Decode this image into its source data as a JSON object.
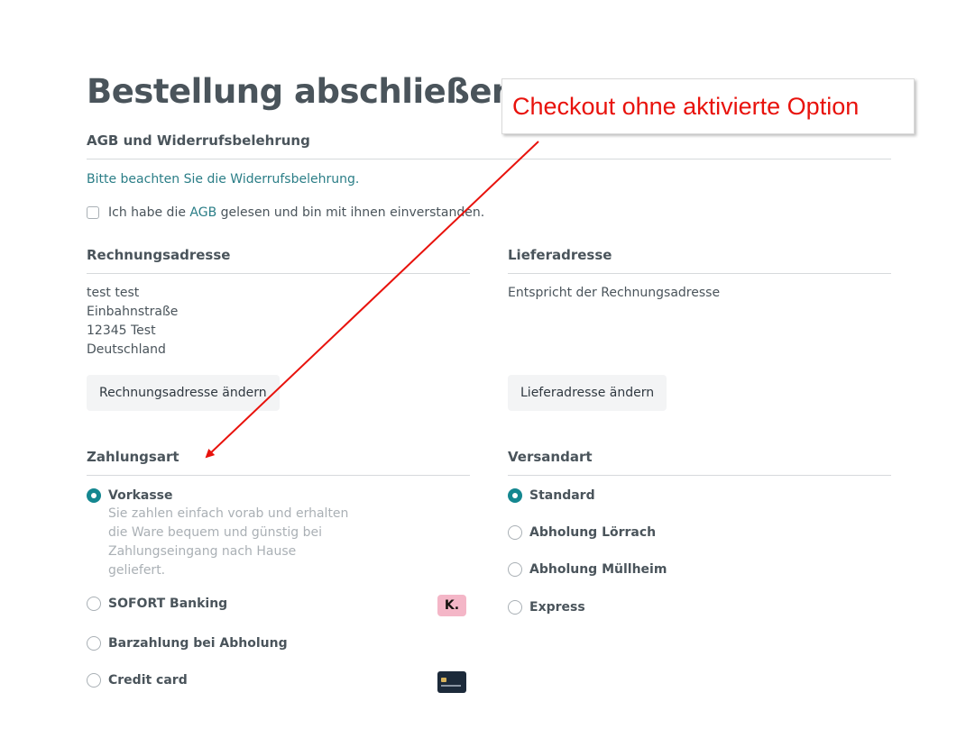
{
  "title": "Bestellung abschließen",
  "terms": {
    "heading": "AGB und Widerrufsbelehrung",
    "notice_prefix": "Bitte beachten Sie die ",
    "notice_link": "Widerrufsbelehrung",
    "notice_suffix": ".",
    "agree_prefix": "Ich habe die ",
    "agree_link": "AGB",
    "agree_suffix": " gelesen und bin mit ihnen einverstanden."
  },
  "billing": {
    "heading": "Rechnungsadresse",
    "lines": [
      "test test",
      "Einbahnstraße",
      "12345 Test",
      "Deutschland"
    ],
    "change_button": "Rechnungsadresse ändern"
  },
  "shipping_address": {
    "heading": "Lieferadresse",
    "text": "Entspricht der Rechnungsadresse",
    "change_button": "Lieferadresse ändern"
  },
  "payment": {
    "heading": "Zahlungsart",
    "options": [
      {
        "label": "Vorkasse",
        "checked": true,
        "description": "Sie zahlen einfach vorab und erhalten die Ware bequem und günstig bei Zahlungseingang nach Hause geliefert."
      },
      {
        "label": "SOFORT Banking",
        "checked": false,
        "icon": "klarna-logo-icon",
        "icon_text": "K."
      },
      {
        "label": "Barzahlung bei Abholung",
        "checked": false
      },
      {
        "label": "Credit card",
        "checked": false,
        "icon": "credit-card-icon"
      }
    ]
  },
  "shipping": {
    "heading": "Versandart",
    "options": [
      {
        "label": "Standard",
        "checked": true
      },
      {
        "label": "Abholung Lörrach",
        "checked": false
      },
      {
        "label": "Abholung Müllheim",
        "checked": false
      },
      {
        "label": "Express",
        "checked": false
      }
    ]
  },
  "annotation": {
    "text": "Checkout ohne aktivierte Option",
    "color": "#e8120c"
  },
  "colors": {
    "accent": "#148790",
    "link": "#2b7e87",
    "text": "#4a545b"
  }
}
